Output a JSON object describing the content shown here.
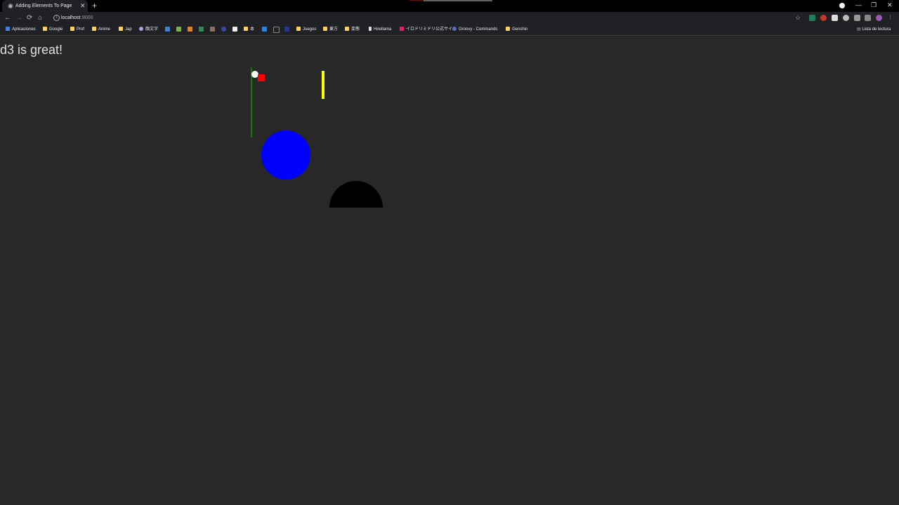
{
  "browser": {
    "tab": {
      "title": "Adding Elements To Page",
      "close": "✕"
    },
    "new_tab": "+",
    "window_controls": {
      "minimize": "—",
      "restore": "❐",
      "close": "✕"
    },
    "nav": {
      "back": "←",
      "forward": "→",
      "reload": "⟳",
      "home": "⌂"
    },
    "address": {
      "host": "localhost",
      "port": ":8000"
    },
    "bookmarks": [
      {
        "label": "Aplicaciones"
      },
      {
        "label": "Google"
      },
      {
        "label": "Prof"
      },
      {
        "label": "Anime"
      },
      {
        "label": "Jap"
      },
      {
        "label": "顔文字"
      },
      {
        "label": "本"
      },
      {
        "label": "Juegos"
      },
      {
        "label": "東方"
      },
      {
        "label": "変態"
      },
      {
        "label": "Hirellama"
      },
      {
        "label": "イロドリミドリ公式サイ..."
      },
      {
        "label": "Groovy - Commands"
      },
      {
        "label": "Genshin"
      }
    ],
    "reading_list": "Lista de lectura",
    "colors": {
      "bookmark_folder": "#fcd15c",
      "background": "#282828"
    }
  },
  "page": {
    "heading": "d3 is great!",
    "shapes": {
      "line_color": "#008000",
      "small_circle_color": "#ffffff",
      "rect_color": "#ff0000",
      "yellow_line_color": "#ffff00",
      "big_circle_color": "#0000ff",
      "arc_color": "#000000"
    }
  }
}
